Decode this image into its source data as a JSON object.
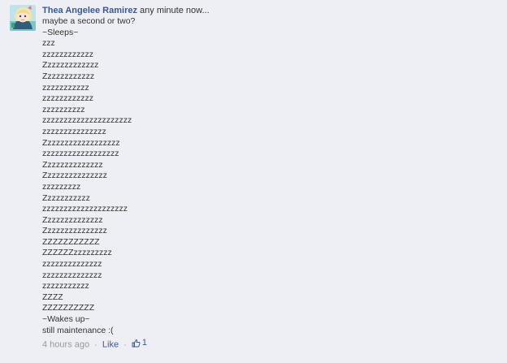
{
  "comment": {
    "author": "Thea Angelee Ramirez",
    "first_line": "any minute now...",
    "lines": [
      "maybe a second or two?",
      "~Sleeps~",
      "zzz",
      "zzzzzzzzzzzz",
      "Zzzzzzzzzzzzz",
      "Zzzzzzzzzzzz",
      "zzzzzzzzzzz",
      "zzzzzzzzzzzz",
      "zzzzzzzzzz",
      "zzzzzzzzzzzzzzzzzzzzz",
      "zzzzzzzzzzzzzzz",
      "Zzzzzzzzzzzzzzzzzz",
      "zzzzzzzzzzzzzzzzzz",
      "Zzzzzzzzzzzzzz",
      "Zzzzzzzzzzzzzzz",
      "zzzzzzzzz",
      "Zzzzzzzzzzz",
      "zzzzzzzzzzzzzzzzzzzz",
      "Zzzzzzzzzzzzzz",
      "Zzzzzzzzzzzzzzz",
      "ZZZZZZZZZZZ",
      "ZZZZZZzzzzzzzzz",
      "zzzzzzzzzzzzzz",
      "zzzzzzzzzzzzzz",
      "zzzzzzzzzzz",
      "ZZZZ",
      "ZZZZZZZZZZ",
      "~Wakes up~",
      "still maintenance :("
    ],
    "timestamp": "4 hours ago",
    "separator": "·",
    "like_label": "Like",
    "like_count": "1"
  },
  "colors": {
    "background": "#edeff4",
    "author_link": "#3b5998",
    "body_text": "#333333",
    "meta_text": "#999999"
  },
  "icons": {
    "avatar": "anime-character-avatar",
    "like": "thumbs-up-icon"
  }
}
